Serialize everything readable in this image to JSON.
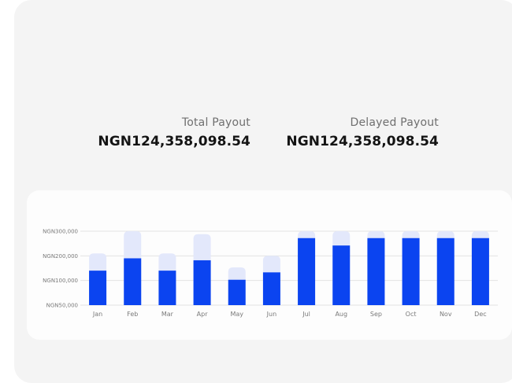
{
  "stats": {
    "total": {
      "label": "Total Payout",
      "value": "NGN124,358,098.54"
    },
    "delayed": {
      "label": "Delayed Payout",
      "value": "NGN124,358,098.54"
    }
  },
  "colors": {
    "primary": "#0b44f0",
    "secondary": "#e3e8fb",
    "grid": "#e2e2e2"
  },
  "chart_data": {
    "type": "bar",
    "stacked": true,
    "categories": [
      "Jan",
      "Feb",
      "Mar",
      "Apr",
      "May",
      "Jun",
      "Jul",
      "Aug",
      "Sep",
      "Oct",
      "Nov",
      "Dec"
    ],
    "yticks": [
      {
        "value": 300000,
        "label": "NGN300,000"
      },
      {
        "value": 200000,
        "label": "NGN200,000"
      },
      {
        "value": 100000,
        "label": "NGN100,000"
      },
      {
        "value": 0,
        "label": "NGN50,000"
      }
    ],
    "ylim": [
      0,
      300000
    ],
    "grid": true,
    "series": [
      {
        "values": [
          140000,
          190000,
          140000,
          182000,
          103000,
          133000,
          272000,
          242000,
          272000,
          272000,
          272000,
          272000
        ]
      },
      {
        "values": [
          70000,
          110000,
          70000,
          106000,
          50000,
          67000,
          28000,
          58000,
          28000,
          28000,
          28000,
          28000
        ]
      }
    ]
  }
}
